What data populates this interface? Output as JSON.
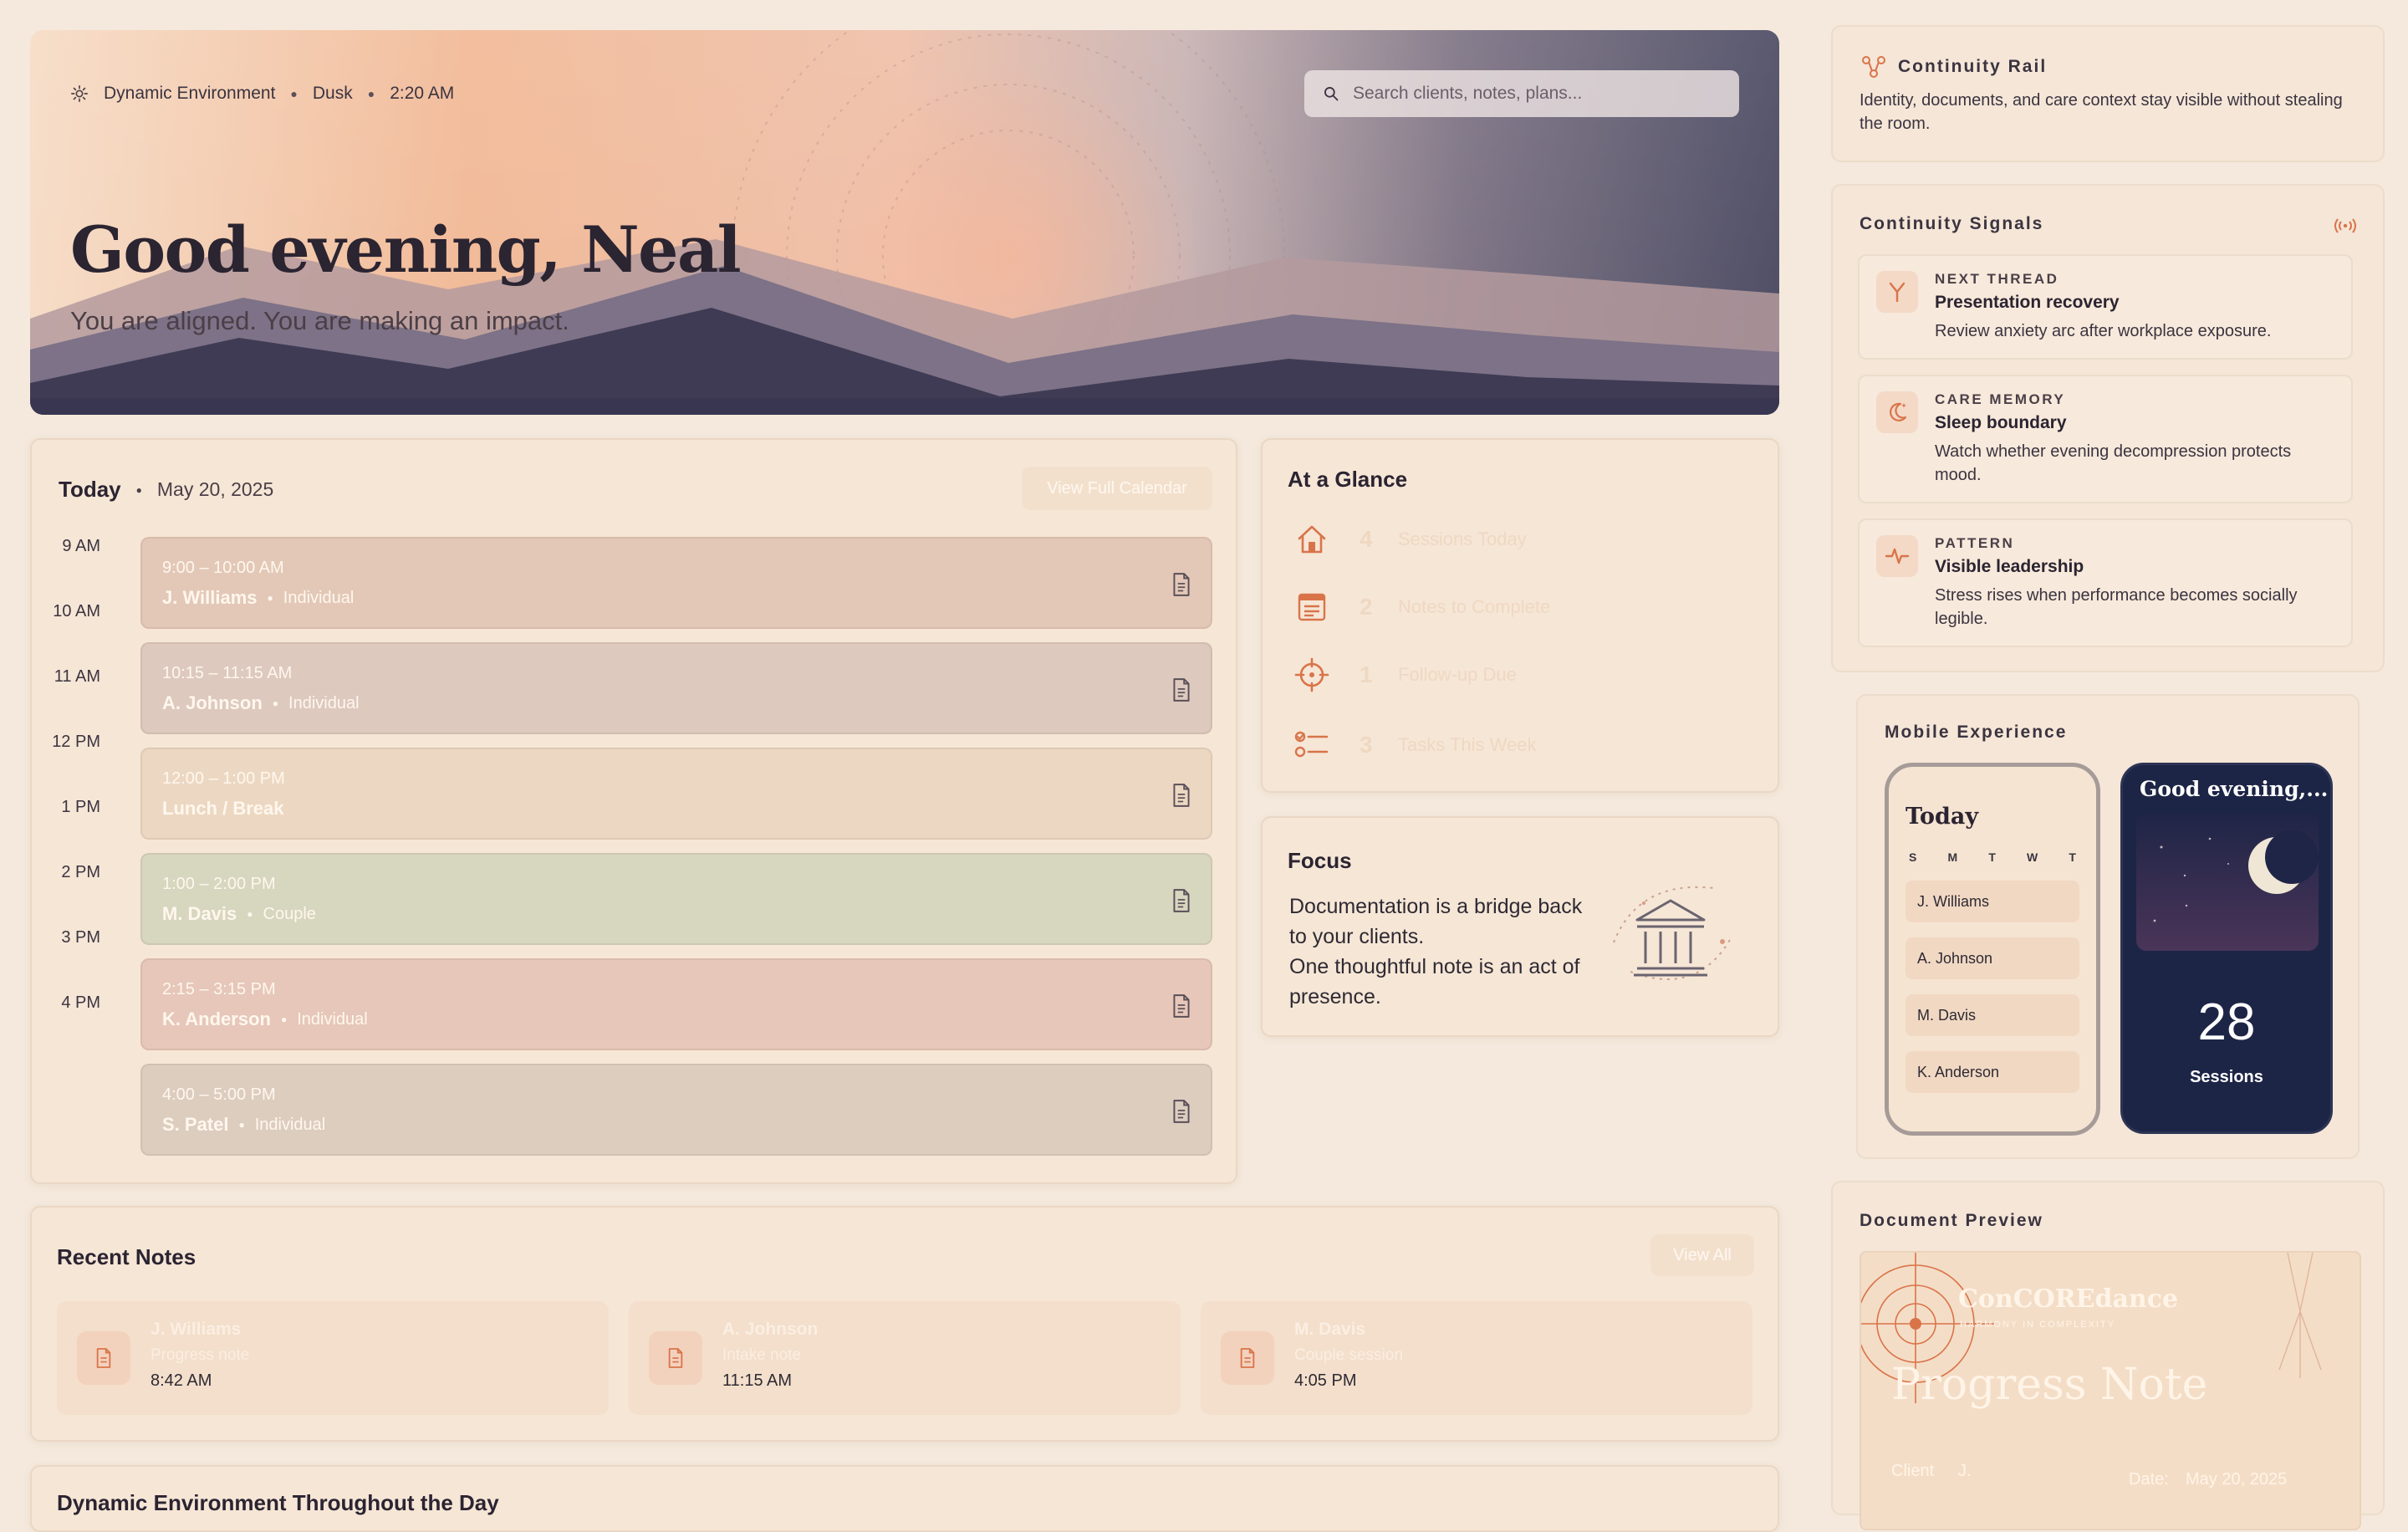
{
  "hero": {
    "env_label": "Dynamic Environment",
    "phase": "Dusk",
    "time": "2:20 AM",
    "greeting": "Good evening, Neal",
    "subtitle": "You are aligned. You are making an impact.",
    "search_placeholder": "Search clients, notes, plans..."
  },
  "schedule": {
    "title": "Today",
    "date": "May 20, 2025",
    "view_calendar_label": "View Full Calendar",
    "time_labels": [
      "9 AM",
      "10 AM",
      "11 AM",
      "12 PM",
      "1 PM",
      "2 PM",
      "3 PM",
      "4 PM"
    ],
    "appointments": [
      {
        "time": "9:00 – 10:00 AM",
        "client": "J. Williams",
        "kind": "Individual"
      },
      {
        "time": "10:15 – 11:15 AM",
        "client": "A. Johnson",
        "kind": "Individual"
      },
      {
        "time": "12:00 – 1:00 PM",
        "client": "Lunch / Break",
        "kind": ""
      },
      {
        "time": "1:00 – 2:00 PM",
        "client": "M. Davis",
        "kind": "Couple"
      },
      {
        "time": "2:15 – 3:15 PM",
        "client": "K. Anderson",
        "kind": "Individual"
      },
      {
        "time": "4:00 – 5:00 PM",
        "client": "S. Patel",
        "kind": "Individual"
      }
    ]
  },
  "glance": {
    "title": "At a Glance",
    "items": [
      {
        "icon": "home-icon",
        "value": "4",
        "label": "Sessions Today"
      },
      {
        "icon": "notes-icon",
        "value": "2",
        "label": "Notes to Complete"
      },
      {
        "icon": "target-icon",
        "value": "1",
        "label": "Follow-up Due"
      },
      {
        "icon": "checklist-icon",
        "value": "3",
        "label": "Tasks This Week"
      }
    ]
  },
  "focus": {
    "title": "Focus",
    "text_line1": "Documentation is a bridge back to your clients.",
    "text_line2": "One thoughtful note is an act of presence."
  },
  "recent_notes": {
    "title": "Recent Notes",
    "view_all_label": "View All",
    "items": [
      {
        "client": "J. Williams",
        "type": "Progress note",
        "time": "8:42 AM"
      },
      {
        "client": "A. Johnson",
        "type": "Intake note",
        "time": "11:15 AM"
      },
      {
        "client": "M. Davis",
        "type": "Couple session",
        "time": "4:05 PM"
      }
    ]
  },
  "dynamic_section": {
    "title": "Dynamic Environment Throughout the Day"
  },
  "rail": {
    "title": "Continuity Rail",
    "desc": "Identity, documents, and care context stay visible without stealing the room."
  },
  "signals": {
    "title": "Continuity Signals",
    "items": [
      {
        "kicker": "NEXT THREAD",
        "title": "Presentation recovery",
        "desc": "Review anxiety arc after workplace exposure."
      },
      {
        "kicker": "CARE MEMORY",
        "title": "Sleep boundary",
        "desc": "Watch whether evening decompression protects mood."
      },
      {
        "kicker": "PATTERN",
        "title": "Visible leadership",
        "desc": "Stress rises when performance becomes socially legible."
      }
    ]
  },
  "mobile": {
    "title": "Mobile Experience",
    "light": {
      "title": "Today",
      "weekdays": [
        "S",
        "M",
        "T",
        "W",
        "T"
      ],
      "clients": [
        "J. Williams",
        "A. Johnson",
        "M. Davis",
        "K. Anderson"
      ]
    },
    "dark": {
      "greeting": "Good evening,...",
      "count": "28",
      "count_label": "Sessions"
    }
  },
  "document_preview": {
    "title": "Document Preview",
    "brand": "ConCOREdance",
    "brand_sub": "Harmony in Complexity",
    "doc_title": "Progress Note",
    "client_label": "Client",
    "client_value": "J.",
    "date_label": "Date:",
    "date_value": "May 20, 2025"
  },
  "colors": {
    "accent": "#d9744a",
    "page_bg": "#f4e9dc",
    "dark_navy": "#1d2546"
  }
}
